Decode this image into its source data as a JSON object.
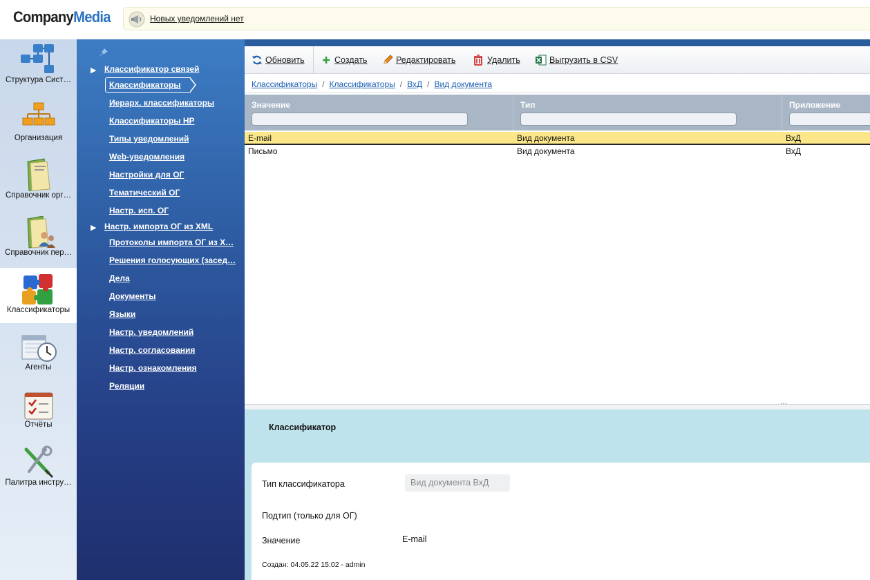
{
  "header": {
    "logo_company": "Company",
    "logo_media": "Media",
    "notification_text": "Новых уведомлений нет"
  },
  "leftbar": {
    "items": [
      {
        "label": "Структура Сист…",
        "icon": "structure-icon"
      },
      {
        "label": "Организация",
        "icon": "org-chart-icon"
      },
      {
        "label": "Справочник орг…",
        "icon": "folder-icon"
      },
      {
        "label": "Справочник пер…",
        "icon": "folder-people-icon"
      },
      {
        "label": "Классификаторы",
        "icon": "puzzle-icon",
        "active": true
      },
      {
        "label": "Агенты",
        "icon": "clock-calendar-icon"
      },
      {
        "label": "Отчёты",
        "icon": "checklist-icon"
      },
      {
        "label": "Палитра инстру…",
        "icon": "tools-icon"
      }
    ]
  },
  "nav": {
    "items": [
      {
        "label": "Классификатор связей",
        "arrow": true
      },
      {
        "label": "Классификаторы",
        "selected": true
      },
      {
        "label": "Иерарх. классификаторы"
      },
      {
        "label": "Классификаторы НР"
      },
      {
        "label": "Типы уведомлений"
      },
      {
        "label": "Web-уведомления"
      },
      {
        "label": "Настройки для ОГ"
      },
      {
        "label": "Тематический ОГ"
      },
      {
        "label": "Настр. исп. ОГ"
      },
      {
        "label": "Настр. импорта ОГ из XML",
        "arrow": true
      },
      {
        "label": "Протоколы импорта ОГ из X…"
      },
      {
        "label": "Решения голосующих (засед…"
      },
      {
        "label": "Дела"
      },
      {
        "label": "Документы"
      },
      {
        "label": "Языки"
      },
      {
        "label": "Настр. уведомлений"
      },
      {
        "label": "Настр. согласования"
      },
      {
        "label": "Настр. ознакомления"
      },
      {
        "label": "Реляции"
      }
    ]
  },
  "toolbar": {
    "refresh": "Обновить",
    "create": "Создать",
    "edit": "Редактировать",
    "delete": "Удалить",
    "export": "Выгрузить в CSV"
  },
  "breadcrumbs": [
    "Классификаторы",
    "Классификаторы",
    "ВхД",
    "Вид документа"
  ],
  "grid": {
    "columns": [
      "Значение",
      "Тип",
      "Приложение"
    ],
    "rows": [
      {
        "value": "E-mail",
        "type": "Вид документа",
        "app": "ВхД",
        "selected": true
      },
      {
        "value": "Письмо",
        "type": "Вид документа",
        "app": "ВхД"
      }
    ]
  },
  "detail": {
    "title": "Классификатор",
    "fields": {
      "type_label": "Тип классификатора",
      "type_value": "Вид документа ВхД",
      "subtype_label": "Подтип (только для ОГ)",
      "value_label": "Значение",
      "value_value": "E-mail"
    },
    "meta": "Создан: 04.05.22 15:02 -  admin"
  }
}
